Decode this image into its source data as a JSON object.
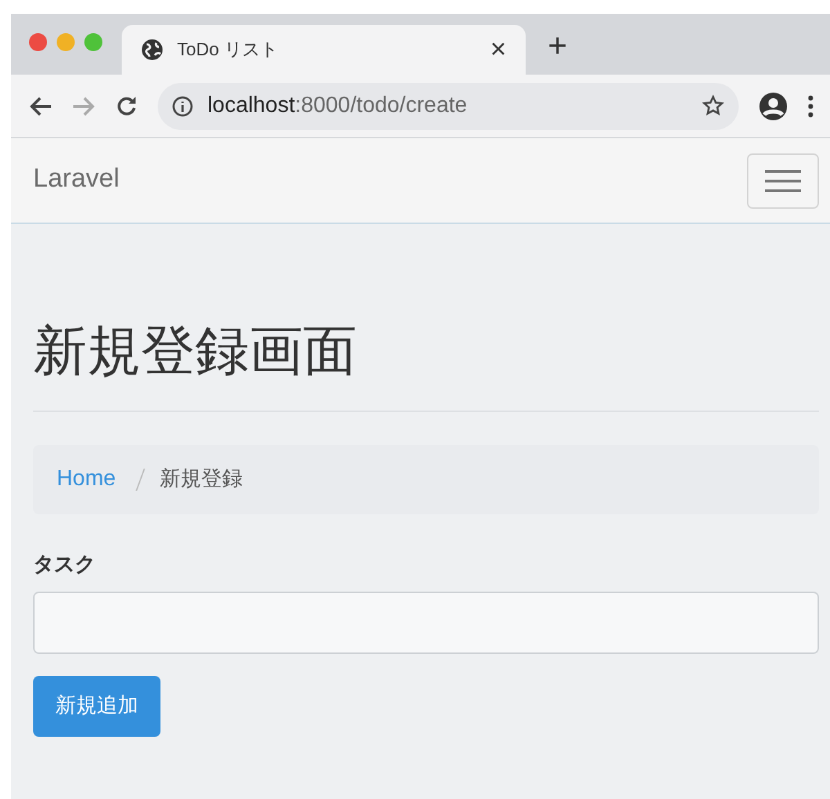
{
  "browser": {
    "tab": {
      "title": "ToDo リスト",
      "close": "×"
    },
    "new_tab": "+",
    "url": "**localhost**:8000/todo/create"
  },
  "navbar": {
    "brand": "Laravel"
  },
  "page": {
    "heading": "新規登録画面",
    "breadcrumb": [
      {
        "label": "Home",
        "kind": "link"
      },
      {
        "label": "新規登録",
        "kind": "current"
      }
    ],
    "field": {
      "label": "タスク"
    },
    "submit": "新規追加"
  }
}
